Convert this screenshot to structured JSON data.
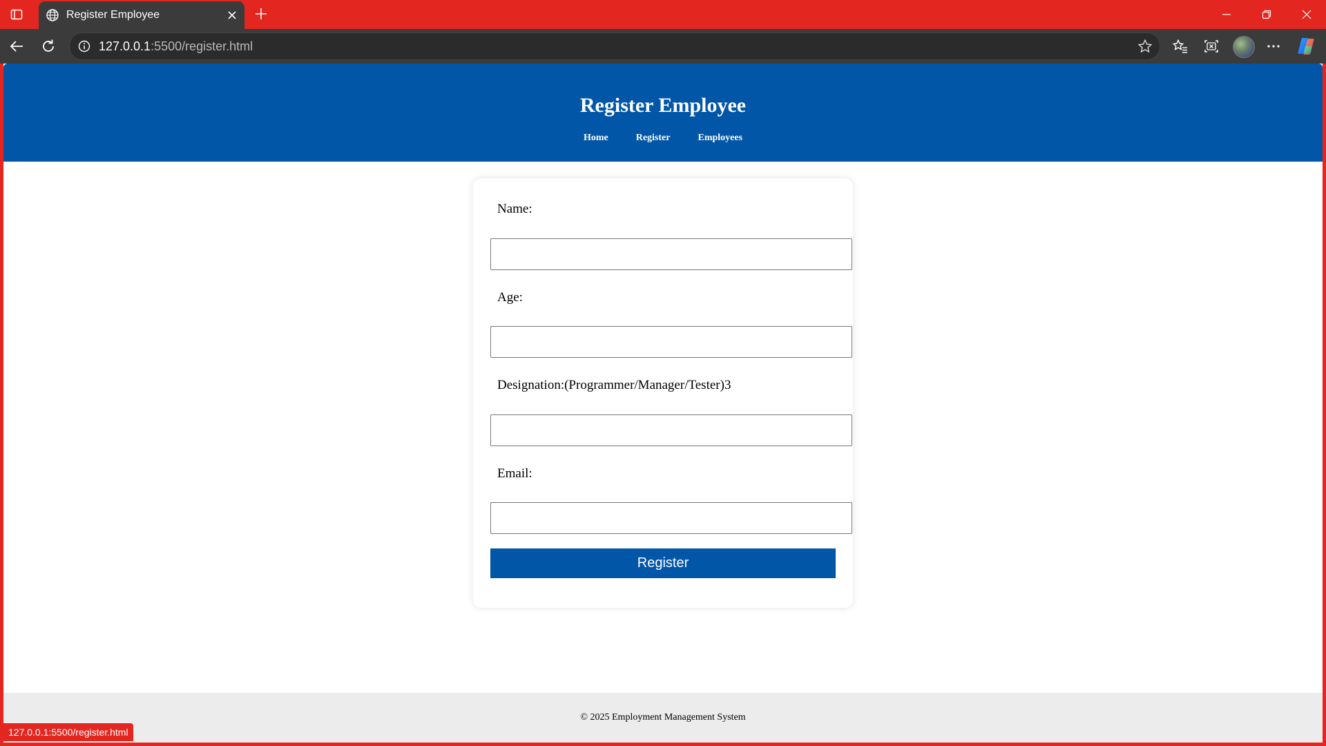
{
  "browser": {
    "tab_title": "Register Employee",
    "url_host": "127.0.0.1",
    "url_path": ":5500/register.html",
    "status_url": "127.0.0.1:5500/register.html",
    "accent_color": "#e42620"
  },
  "header": {
    "title": "Register Employee",
    "nav": [
      "Home",
      "Register",
      "Employees"
    ],
    "color": "#0256a8"
  },
  "form": {
    "name_label": "Name:",
    "name_value": "",
    "age_label": "Age:",
    "age_value": "",
    "designation_label": "Designation:(Programmer/Manager/Tester)3",
    "designation_value": "",
    "email_label": "Email:",
    "email_value": "",
    "submit_label": "Register"
  },
  "footer": {
    "text": "© 2025 Employment Management System"
  },
  "icons": {
    "tab_actions": "tab-actions-icon",
    "favicon": "globe-icon",
    "close_tab": "close-icon",
    "new_tab": "plus-icon",
    "back": "back-arrow-icon",
    "reload": "reload-icon",
    "site_info": "info-icon",
    "favorite": "star-icon",
    "favorites": "favorites-icon",
    "screenshot": "screenshot-icon",
    "profile": "avatar",
    "more": "more-icon",
    "copilot": "copilot-icon"
  }
}
